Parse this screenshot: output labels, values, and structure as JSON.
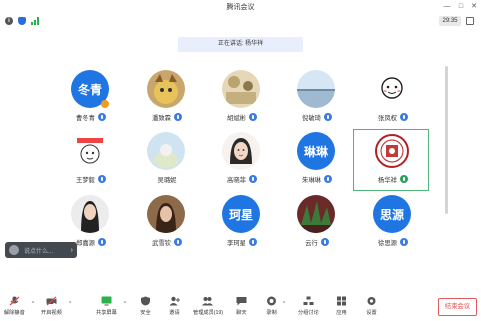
{
  "window": {
    "title": "腾讯会议",
    "time": "29:35"
  },
  "banner": {
    "speaking": "正在讲话: 杨华祥"
  },
  "participants": [
    {
      "name": "曹冬青",
      "avatar_text": "冬青",
      "mic": "blue"
    },
    {
      "name": "潘致霖",
      "avatar_text": "",
      "mic": "blue"
    },
    {
      "name": "胡斌彬",
      "avatar_text": "",
      "mic": "blue"
    },
    {
      "name": "倪敏琦",
      "avatar_text": "",
      "mic": "blue"
    },
    {
      "name": "张凤权",
      "avatar_text": "",
      "mic": "blue"
    },
    {
      "name": "王梦毅",
      "avatar_text": "",
      "mic": "blue"
    },
    {
      "name": "吴璐妮",
      "avatar_text": "",
      "mic": "blue"
    },
    {
      "name": "高晓菲",
      "avatar_text": "",
      "mic": "blue"
    },
    {
      "name": "朱琳琳",
      "avatar_text": "琳琳",
      "mic": "blue"
    },
    {
      "name": "杨华祥",
      "avatar_text": "",
      "mic": "green"
    },
    {
      "name": "郑嘉源",
      "avatar_text": "",
      "mic": "blue"
    },
    {
      "name": "武雪钦",
      "avatar_text": "",
      "mic": "blue"
    },
    {
      "name": "李珂星",
      "avatar_text": "珂星",
      "mic": "blue"
    },
    {
      "name": "云行",
      "avatar_text": "",
      "mic": "blue"
    },
    {
      "name": "徐思源",
      "avatar_text": "思源",
      "mic": "blue"
    }
  ],
  "chat": {
    "placeholder": "说点什么..."
  },
  "toolbar": {
    "unmute": "解除静音",
    "video": "开启视频",
    "share": "共享屏幕",
    "security": "安全",
    "invite": "邀请",
    "members": "管理成员(19)",
    "chat": "聊天",
    "record": "录制",
    "breakout": "分组讨论",
    "apps": "应用",
    "settings": "设置",
    "end": "结束会议"
  },
  "colors": {
    "accent": "#1f76e3",
    "end": "#e04848",
    "speaking_mic": "#25a35a"
  }
}
